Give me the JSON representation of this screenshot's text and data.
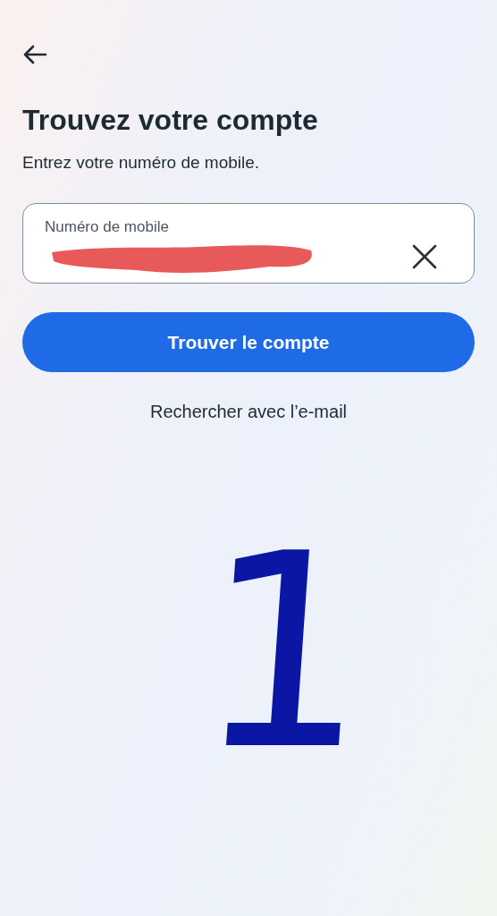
{
  "title": "Trouvez votre compte",
  "subtitle": "Entrez votre numéro de mobile.",
  "field": {
    "label": "Numéro de mobile",
    "redacted": true,
    "clearable": true
  },
  "primary_button": "Trouver le compte",
  "link": "Rechercher avec l’e-mail",
  "annotation": "1"
}
